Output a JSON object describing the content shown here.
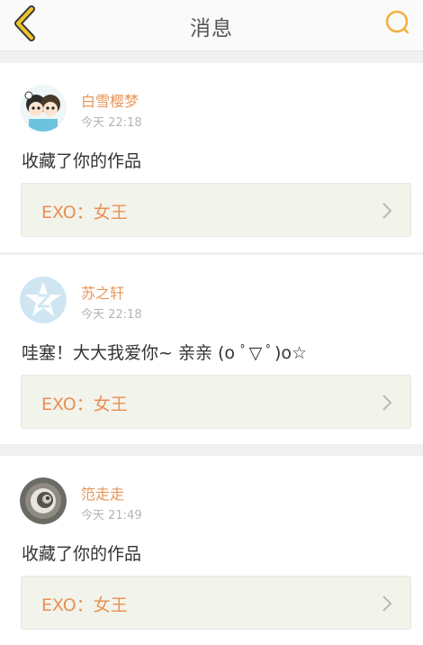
{
  "header": {
    "title": "消息",
    "back_icon": "back-chevron-icon",
    "search_icon": "search-icon",
    "accent_color": "#f2b03a"
  },
  "messages": [
    {
      "username": "白雪樱梦",
      "time": "今天 22:18",
      "content": "收藏了你的作品",
      "work_title": "EXO：女王",
      "avatar": "cartoon-couple-avatar"
    },
    {
      "username": "苏之轩",
      "time": "今天 22:18",
      "content": "哇塞！大大我爱你~ 亲亲 (o ﾟ▽ ﾟ)o☆",
      "work_title": "EXO：女王",
      "avatar": "default-star-avatar"
    },
    {
      "username": "笵走走",
      "time": "今天 21:49",
      "content": "收藏了你的作品",
      "work_title": "EXO：女王",
      "avatar": "swirl-photo-avatar"
    }
  ],
  "colors": {
    "username": "#e8955a",
    "work_title": "#e98f52",
    "link_bg": "#f2f3eb",
    "page_bg": "#f0f0f0"
  }
}
